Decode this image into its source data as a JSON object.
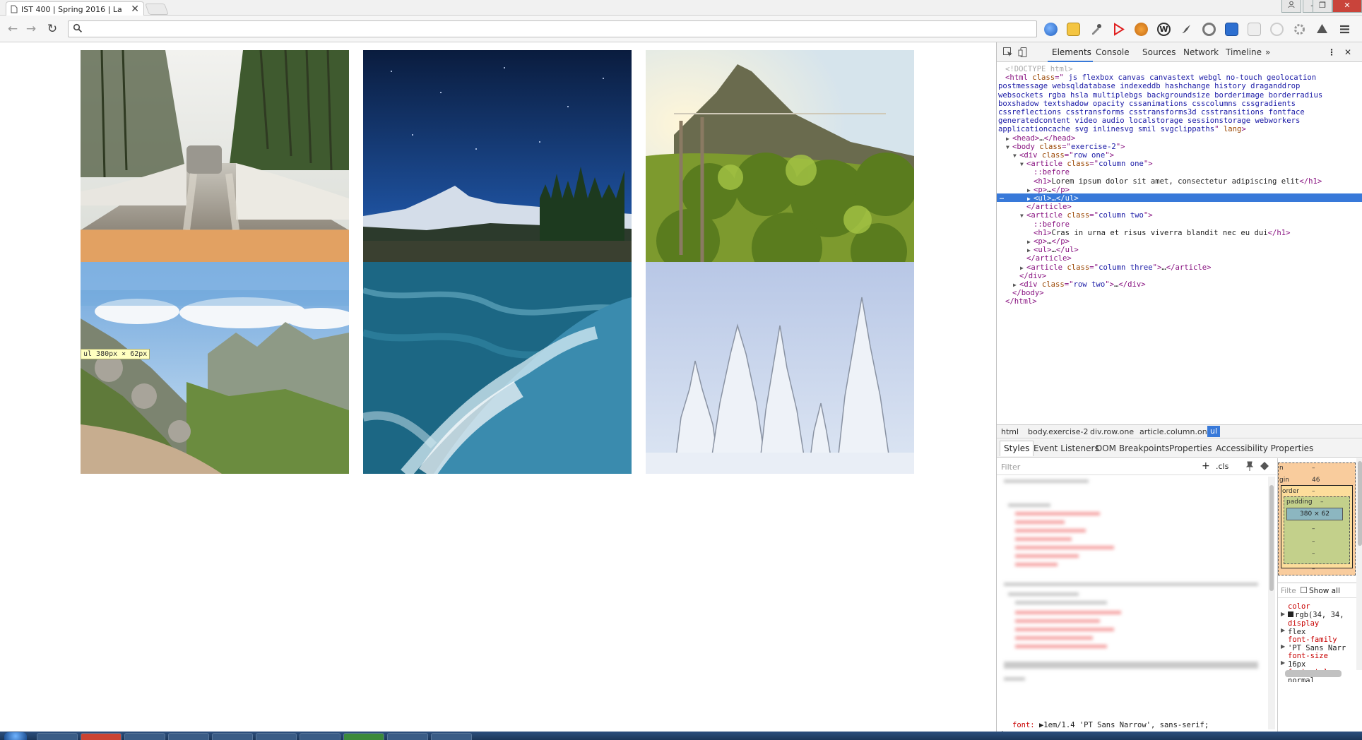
{
  "browser": {
    "tab_title": "IST 400 | Spring 2016 | La",
    "tab_close": "✕",
    "window_buttons": [
      "–",
      "❐",
      "✕"
    ],
    "nav": {
      "back": "←",
      "forward": "→",
      "reload": "↻"
    },
    "omnibox_value": ""
  },
  "page": {
    "photos": [
      {
        "name": "photo-snowy-road",
        "subject": "snowy forest road with car"
      },
      {
        "name": "photo-night-mountain",
        "subject": "starry night sky over mountain"
      },
      {
        "name": "photo-vineyard-hill",
        "subject": "sunlit vineyard on a hill"
      },
      {
        "name": "photo-rocky-valley",
        "subject": "rocky green mountain valley"
      },
      {
        "name": "photo-water-waves",
        "subject": "blue water waves"
      },
      {
        "name": "photo-snowy-trees",
        "subject": "snow-covered trees"
      }
    ],
    "tooltip": "ul 380px × 62px"
  },
  "devtools": {
    "tabs": [
      "Elements",
      "Console",
      "Sources",
      "Network",
      "Timeline"
    ],
    "more_tabs": "»",
    "menu": "⋮",
    "close": "✕",
    "dom_lines": [
      {
        "indent": 0,
        "parts": [
          [
            "cmt",
            "<!DOCTYPE html>"
          ]
        ]
      },
      {
        "indent": 0,
        "parts": [
          [
            "tag",
            "<html "
          ],
          [
            "attr",
            "class"
          ],
          [
            "tag",
            "=\""
          ],
          [
            "val",
            " js flexbox canvas canvastext webgl no-touch geolocation"
          ]
        ]
      },
      {
        "indent": -1,
        "parts": [
          [
            "val",
            "postmessage websqldatabase indexeddb hashchange history draganddrop"
          ]
        ]
      },
      {
        "indent": -1,
        "parts": [
          [
            "val",
            "websockets rgba hsla multiplebgs backgroundsize borderimage borderradius"
          ]
        ]
      },
      {
        "indent": -1,
        "parts": [
          [
            "val",
            "boxshadow textshadow opacity cssanimations csscolumns cssgradients"
          ]
        ]
      },
      {
        "indent": -1,
        "parts": [
          [
            "val",
            "cssreflections csstransforms csstransforms3d csstransitions fontface"
          ]
        ]
      },
      {
        "indent": -1,
        "parts": [
          [
            "val",
            "generatedcontent video audio localstorage sessionstorage webworkers"
          ]
        ]
      },
      {
        "indent": -1,
        "parts": [
          [
            "val",
            "applicationcache svg inlinesvg smil svgclippaths"
          ],
          [
            "tag",
            "\" "
          ],
          [
            "attr",
            "lang"
          ],
          [
            "tag",
            ">"
          ]
        ]
      },
      {
        "indent": 1,
        "tri": "▶",
        "parts": [
          [
            "tag",
            "<head>"
          ],
          [
            "txt",
            "…"
          ],
          [
            "tag",
            "</head>"
          ]
        ]
      },
      {
        "indent": 1,
        "tri": "▼",
        "parts": [
          [
            "tag",
            "<body "
          ],
          [
            "attr",
            "class"
          ],
          [
            "tag",
            "=\""
          ],
          [
            "val",
            "exercise-2"
          ],
          [
            "tag",
            "\">"
          ]
        ]
      },
      {
        "indent": 2,
        "tri": "▼",
        "parts": [
          [
            "tag",
            "<div "
          ],
          [
            "attr",
            "class"
          ],
          [
            "tag",
            "=\""
          ],
          [
            "val",
            "row one"
          ],
          [
            "tag",
            "\">"
          ]
        ]
      },
      {
        "indent": 3,
        "tri": "▼",
        "parts": [
          [
            "tag",
            "<article "
          ],
          [
            "attr",
            "class"
          ],
          [
            "tag",
            "=\""
          ],
          [
            "val",
            "column one"
          ],
          [
            "tag",
            "\">"
          ]
        ]
      },
      {
        "indent": 4,
        "parts": [
          [
            "pseudo",
            "::before"
          ]
        ]
      },
      {
        "indent": 4,
        "parts": [
          [
            "tag",
            "<h1>"
          ],
          [
            "txt",
            "Lorem ipsum dolor sit amet, consectetur adipiscing elit"
          ],
          [
            "tag",
            "</h1>"
          ]
        ]
      },
      {
        "indent": 4,
        "tri": "▶",
        "parts": [
          [
            "tag",
            "<p>"
          ],
          [
            "txt",
            "…"
          ],
          [
            "tag",
            "</p>"
          ]
        ]
      },
      {
        "indent": 4,
        "tri": "▶",
        "selected": true,
        "parts": [
          [
            "tag",
            "<ul>"
          ],
          [
            "txt",
            "…"
          ],
          [
            "tag",
            "</ul>"
          ]
        ]
      },
      {
        "indent": 3,
        "parts": [
          [
            "tag",
            "</article>"
          ]
        ]
      },
      {
        "indent": 3,
        "tri": "▼",
        "parts": [
          [
            "tag",
            "<article "
          ],
          [
            "attr",
            "class"
          ],
          [
            "tag",
            "=\""
          ],
          [
            "val",
            "column two"
          ],
          [
            "tag",
            "\">"
          ]
        ]
      },
      {
        "indent": 4,
        "parts": [
          [
            "pseudo",
            "::before"
          ]
        ]
      },
      {
        "indent": 4,
        "parts": [
          [
            "tag",
            "<h1>"
          ],
          [
            "txt",
            "Cras in urna et risus viverra blandit nec eu dui"
          ],
          [
            "tag",
            "</h1>"
          ]
        ]
      },
      {
        "indent": 4,
        "tri": "▶",
        "parts": [
          [
            "tag",
            "<p>"
          ],
          [
            "txt",
            "…"
          ],
          [
            "tag",
            "</p>"
          ]
        ]
      },
      {
        "indent": 4,
        "tri": "▶",
        "parts": [
          [
            "tag",
            "<ul>"
          ],
          [
            "txt",
            "…"
          ],
          [
            "tag",
            "</ul>"
          ]
        ]
      },
      {
        "indent": 3,
        "parts": [
          [
            "tag",
            "</article>"
          ]
        ]
      },
      {
        "indent": 3,
        "tri": "▶",
        "parts": [
          [
            "tag",
            "<article "
          ],
          [
            "attr",
            "class"
          ],
          [
            "tag",
            "=\""
          ],
          [
            "val",
            "column three"
          ],
          [
            "tag",
            "\">"
          ],
          [
            "txt",
            "…"
          ],
          [
            "tag",
            "</article>"
          ]
        ]
      },
      {
        "indent": 2,
        "parts": [
          [
            "tag",
            "</div>"
          ]
        ]
      },
      {
        "indent": 2,
        "tri": "▶",
        "parts": [
          [
            "tag",
            "<div "
          ],
          [
            "attr",
            "class"
          ],
          [
            "tag",
            "=\""
          ],
          [
            "val",
            "row two"
          ],
          [
            "tag",
            "\">"
          ],
          [
            "txt",
            "…"
          ],
          [
            "tag",
            "</div>"
          ]
        ]
      },
      {
        "indent": 1,
        "parts": [
          [
            "tag",
            "</body>"
          ]
        ]
      },
      {
        "indent": 0,
        "parts": [
          [
            "tag",
            "</html>"
          ]
        ]
      }
    ],
    "selection_marker": "…",
    "breadcrumbs": [
      "html",
      "body.exercise-2",
      "div.row.one",
      "article.column.one",
      "ul"
    ],
    "sub_tabs": [
      "Styles",
      "Event Listeners",
      "DOM Breakpoints",
      "Properties",
      "Accessibility Properties"
    ],
    "styles_filter_placeholder": "Filter",
    "styles_toolbar": {
      "add": "+",
      "cls": ".cls"
    },
    "font_shorthand": {
      "prop": "font:",
      "value": "▶1em/1.4 'PT Sans Narrow', sans-serif;"
    },
    "closing_brace": "}",
    "box_model": {
      "labels": {
        "position": "n",
        "margin": "gin",
        "border": "order",
        "padding": "padding"
      },
      "dash": "–",
      "margin_value": "46",
      "content": "380 × 62"
    },
    "computed_filter": "Filte",
    "show_all": "Show all",
    "computed": [
      {
        "name": "color",
        "value": "rgb(34, 34,"
      },
      {
        "name": "display",
        "value": "flex"
      },
      {
        "name": "font-family",
        "value": "'PT Sans Narr"
      },
      {
        "name": "font-size",
        "value": "16px"
      },
      {
        "name": "font-style",
        "value": "normal"
      }
    ],
    "colors": {
      "selection": "#3879d9",
      "margin": "#f9cc9d",
      "border": "#fddd9b",
      "padding": "#c3d08b",
      "content": "#8cb6c0"
    }
  }
}
